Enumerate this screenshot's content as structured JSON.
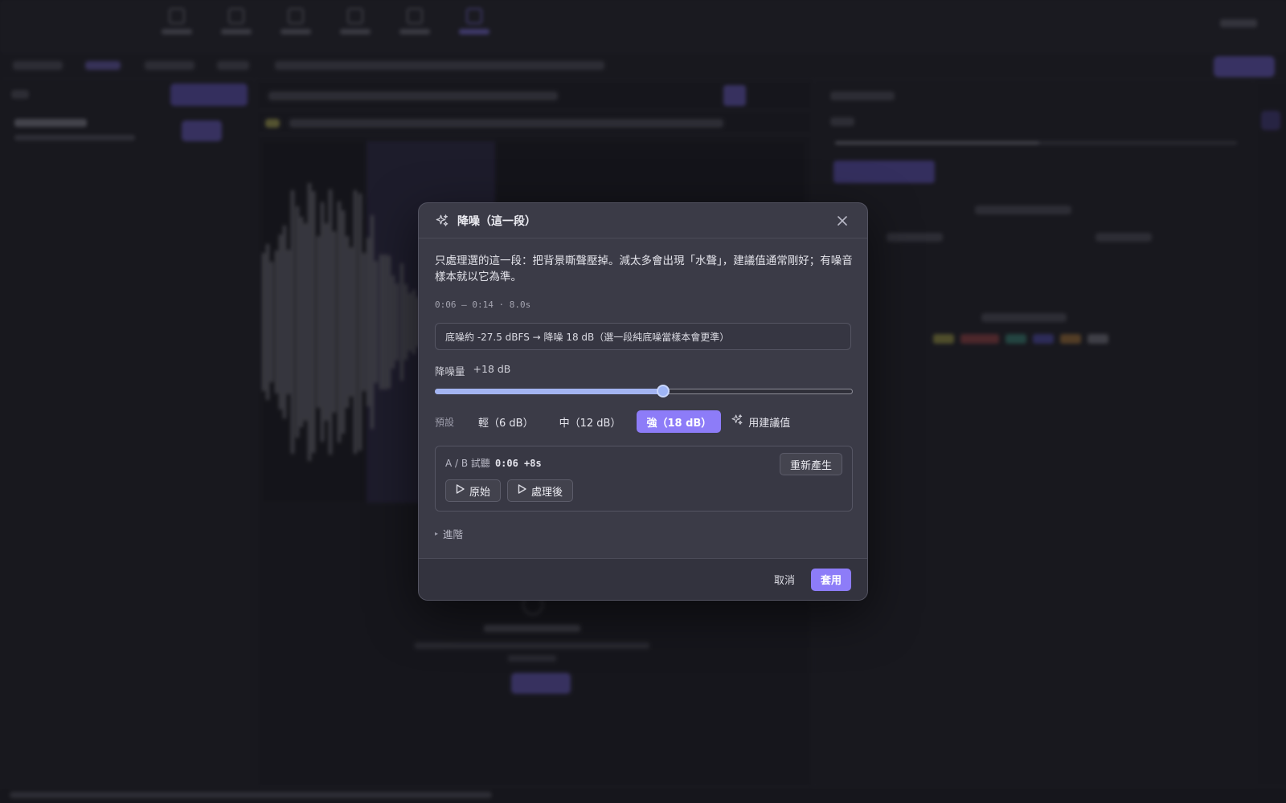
{
  "colors": {
    "accent": "#8d7cf8",
    "slider_fill": "#a3b4f2",
    "modal_bg": "#3b3b47",
    "app_bg": "#1f1f25"
  },
  "background": {
    "nav_items": [
      "nav-icon-1",
      "nav-icon-2",
      "nav-icon-3",
      "nav-icon-4",
      "nav-icon-5",
      "nav-icon-6"
    ]
  },
  "dialog": {
    "title": "降噪（這一段）",
    "header_icon": "sparkles-icon",
    "close_icon": "close-icon",
    "description": "只處理選的這一段：把背景嘶聲壓掉。減太多會出現「水聲」，建議值通常剛好；有噪音樣本就以它為準。",
    "range": "0:06 – 0:14 · 8.0s",
    "info": "底噪約 -27.5 dBFS → 降噪 18 dB（選一段純底噪當樣本會更準）",
    "amount": {
      "label": "降噪量",
      "value_text": "+18 dB",
      "value": 18,
      "min": 0,
      "max": 33
    },
    "presets": {
      "label": "預設",
      "items": [
        {
          "label": "輕（6 dB）",
          "active": false
        },
        {
          "label": "中（12 dB）",
          "active": false
        },
        {
          "label": "強（18 dB）",
          "active": true
        }
      ],
      "suggest_label": "用建議值"
    },
    "ab": {
      "title": "A / B 試聽",
      "time": "0:06 +8s",
      "regen_label": "重新產生",
      "original_label": "原始",
      "processed_label": "處理後"
    },
    "advanced_label": "進階",
    "footer": {
      "cancel_label": "取消",
      "apply_label": "套用"
    }
  }
}
